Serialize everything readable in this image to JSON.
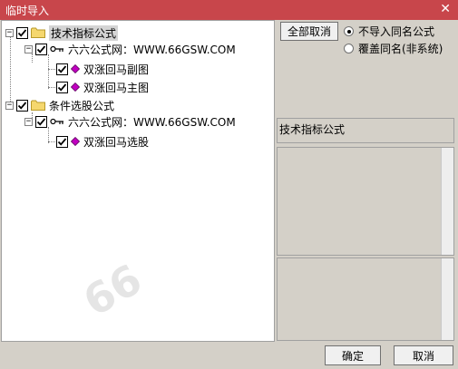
{
  "window": {
    "title": "临时导入",
    "close_glyph": "✕"
  },
  "tree": {
    "group1": {
      "label": "技术指标公式"
    },
    "group1_source": {
      "label": "六六公式网：WWW.66GSW.COM"
    },
    "group1_items": [
      "双涨回马副图",
      "双涨回马主图"
    ],
    "group2": {
      "label": "条件选股公式"
    },
    "group2_source": {
      "label": "六六公式网：WWW.66GSW.COM"
    },
    "group2_items": [
      "双涨回马选股"
    ]
  },
  "right": {
    "cancel_all": "全部取消",
    "option_skip": "不导入同名公式",
    "option_overwrite": "覆盖同名(非系统)",
    "info_label": "技术指标公式"
  },
  "footer": {
    "ok": "确定",
    "cancel": "取消"
  },
  "colors": {
    "titlebar": "#c8464b",
    "folder": "#f5d76e",
    "diamond": "#c000c0"
  }
}
